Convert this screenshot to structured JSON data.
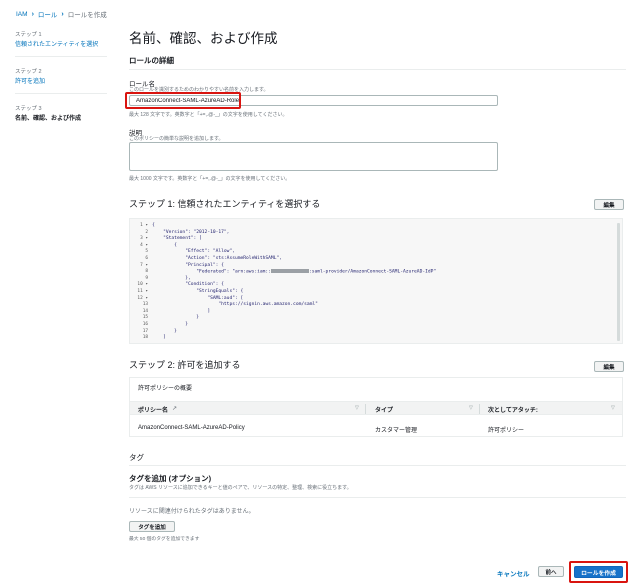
{
  "breadcrumb": {
    "iam": "IAM",
    "roles": "ロール",
    "current": "ロールを作成"
  },
  "sidebar": {
    "steps": [
      {
        "num": "ステップ 1",
        "label": "信頼されたエンティティを選択"
      },
      {
        "num": "ステップ 2",
        "label": "許可を追加"
      },
      {
        "num": "ステップ 3",
        "label": "名前、確認、および作成"
      }
    ]
  },
  "page_title": "名前、確認、および作成",
  "role_details": {
    "title": "ロールの詳細",
    "name_label": "ロール名",
    "name_help": "このロールを識別するためのわかりやすい名前を入力します。",
    "name_value": "AmazonConnect-SAML-AzureAD-Role",
    "name_constraint": "最大 128 文字です。英数字と「+=,.@-_」の文字を使用してください。",
    "desc_label": "説明",
    "desc_help": "このポリシーの簡単な説明を追加します。",
    "desc_constraint": "最大 1000 文字です。英数字と「+=,.@-_」の文字を使用してください。"
  },
  "step1": {
    "title": "ステップ 1: 信頼されたエンティティを選択する",
    "edit": "編集",
    "gutter": [
      "1 ▾",
      "2",
      "3 ▾",
      "4 ▾",
      "5",
      "6",
      "7 ▾",
      "8",
      "9",
      "10 ▾",
      "11 ▾",
      "12 ▾",
      "13",
      "14",
      "15",
      "16",
      "17",
      "18"
    ],
    "code": [
      "{",
      "    \"Version\": \"2012-10-17\",",
      "    \"Statement\": [",
      "        {",
      "            \"Effect\": \"Allow\",",
      "            \"Action\": \"sts:AssumeRoleWithSAML\",",
      "            \"Principal\": {",
      "                \"Federated\": \"arn:aws:iam::",
      "            },",
      "            \"Condition\": {",
      "                \"StringEquals\": {",
      "                    \"SAML:aud\": [",
      "                        \"https://signin.aws.amazon.com/saml\"",
      "                    ]",
      "                }",
      "            }",
      "        }",
      "    ]"
    ],
    "line8_suffix": ":saml-provider/AmazonConnect-SAML-AzureAD-IdP\""
  },
  "step2": {
    "title": "ステップ 2: 許可を追加する",
    "edit": "編集",
    "summary_title": "許可ポリシーの概要",
    "columns": [
      "ポリシー名",
      "タイプ",
      "次としてアタッチ:"
    ],
    "rows": [
      {
        "policy": "AmazonConnect-SAML-AzureAD-Policy",
        "type": "カスタマー管理",
        "attached": "許可ポリシー"
      }
    ]
  },
  "tags": {
    "heading": "タグ",
    "title": "タグを追加 (オプション)",
    "desc": "タグは AWS リソースに追加できるキーと値のペアで、リソースの特定、整理、検索に役立ちます。",
    "empty": "リソースに関連付けられたタグはありません。",
    "add_button": "タグを追加",
    "limit": "最大 50 個のタグを追加できます"
  },
  "footer": {
    "cancel": "キャンセル",
    "back": "前へ",
    "create": "ロールを作成"
  },
  "colors": {
    "link": "#0073bb",
    "primary": "#1672c9",
    "highlight": "#d9140f"
  }
}
